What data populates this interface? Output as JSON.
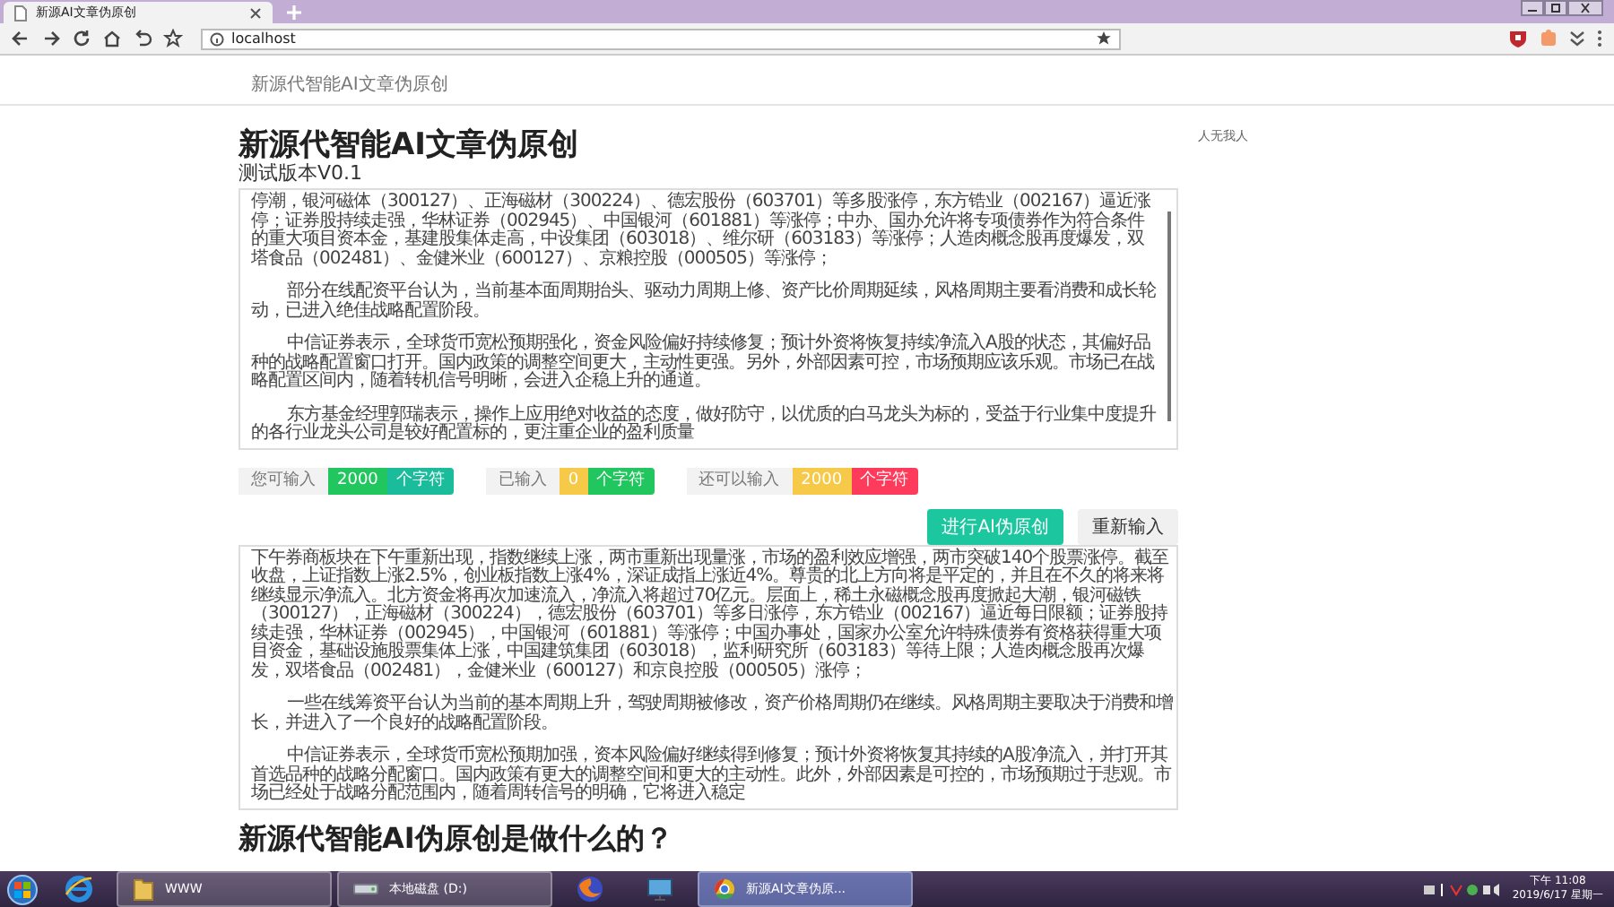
{
  "browser": {
    "tab_title": "新源AI文章伪原创",
    "address": "localhost"
  },
  "nav": {
    "brand": "新源代智能AI文章伪原创"
  },
  "header": {
    "title": "新源代智能AI文章伪原创",
    "subtitle": "测试版本V0.1",
    "aside": "人无我人"
  },
  "input_panel": {
    "paragraphs": [
      {
        "text": "停潮，银河磁体（300127）、正海磁材（300224）、德宏股份（603701）等多股涨停，东方锆业（002167）逼近涨停；证券股持续走强，华林证券（002945）、中国银河（601881）等涨停；中办、国办允许将专项债券作为符合条件的重大项目资本金，基建股集体走高，中设集团（603018）、维尔研（603183）等涨停；人造肉概念股再度爆发，双塔食品（002481）、金健米业（600127）、京粮控股（000505）等涨停；",
        "indented": false
      },
      {
        "text": "部分在线配资平台认为，当前基本面周期抬头、驱动力周期上修、资产比价周期延续，风格周期主要看消费和成长轮动，已进入绝佳战略配置阶段。",
        "indented": true
      },
      {
        "text": "中信证券表示，全球货币宽松预期强化，资金风险偏好持续修复；预计外资将恢复持续净流入A股的状态，其偏好品种的战略配置窗口打开。国内政策的调整空间更大，主动性更强。另外，外部因素可控，市场预期应该乐观。市场已在战略配置区间内，随着转机信号明晰，会进入企稳上升的通道。",
        "indented": true
      },
      {
        "text": "东方基金经理郭瑞表示，操作上应用绝对收益的态度，做好防守，以优质的白马龙头为标的，受益于行业集中度提升的各行业龙头公司是较好配置标的，更注重企业的盈利质量",
        "indented": true
      }
    ]
  },
  "counters": [
    {
      "label": "您可输入",
      "number": {
        "text": "2000",
        "color": "#21c65e"
      },
      "unit": {
        "text": "个字符",
        "color": "#1abc9c"
      }
    },
    {
      "label": "已输入",
      "number": {
        "text": "0",
        "color": "#f7c948"
      },
      "unit": {
        "text": "个字符",
        "color": "#21c65e"
      }
    },
    {
      "label": "还可以输入",
      "number": {
        "text": "2000",
        "color": "#f7c948"
      },
      "unit": {
        "text": "个字符",
        "color": "#ff3b5c"
      }
    }
  ],
  "buttons": [
    {
      "label": "进行AI伪原创",
      "kind": "primary"
    },
    {
      "label": "重新输入",
      "kind": "default"
    }
  ],
  "output_panel": {
    "paragraphs": [
      {
        "text": "下午券商板块在下午重新出现，指数继续上涨，两市重新出现量涨，市场的盈利效应增强，两市突破140个股票涨停。截至收盘，上证指数上涨2.5%，创业板指数上涨4%，深证成指上涨近4%。尊贵的北上方向将是平定的，并且在不久的将来将继续显示净流入。北方资金将再次加速流入，净流入将超过70亿元。层面上，稀土永磁概念股再度掀起大潮，银河磁铁（300127），正海磁材（300224），德宏股份（603701）等多日涨停，东方锆业（002167）逼近每日限额；证券股持续走强，华林证券（002945），中国银河（601881）等涨停；中国办事处，国家办公室允许特殊债券有资格获得重大项目资金，基础设施股票集体上涨，中国建筑集团（603018），监利研究所（603183）等待上限；人造肉概念股再次爆发，双塔食品（002481），金健米业（600127）和京良控股（000505）涨停；",
        "indented": false
      },
      {
        "text": "一些在线筹资平台认为当前的基本周期上升，驾驶周期被修改，资产价格周期仍在继续。风格周期主要取决于消费和增长，并进入了一个良好的战略配置阶段。",
        "indented": true
      },
      {
        "text": "中信证券表示，全球货币宽松预期加强，资本风险偏好继续得到修复；预计外资将恢复其持续的A股净流入，并打开其首选品种的战略分配窗口。国内政策有更大的调整空间和更大的主动性。此外，外部因素是可控的，市场预期过于悲观。市场已经处于战略分配范围内，随着周转信号的明确，它将进入稳定",
        "indented": true
      }
    ]
  },
  "section_heading": "新源代智能AI伪原创是做什么的？",
  "taskbar": {
    "items": [
      {
        "kind": "e-logo",
        "selected": false
      },
      {
        "kind": "folder",
        "label": "WWW",
        "selected": false
      },
      {
        "kind": "drive",
        "label": "本地磁盘 (D:)",
        "selected": false
      },
      {
        "kind": "fox",
        "selected": false
      },
      {
        "kind": "monitor",
        "selected": false
      },
      {
        "kind": "browser",
        "label": "新源AI文章伪原...",
        "selected": true
      }
    ],
    "time": "下午 11:08",
    "date": "2019/6/17 星期一"
  }
}
